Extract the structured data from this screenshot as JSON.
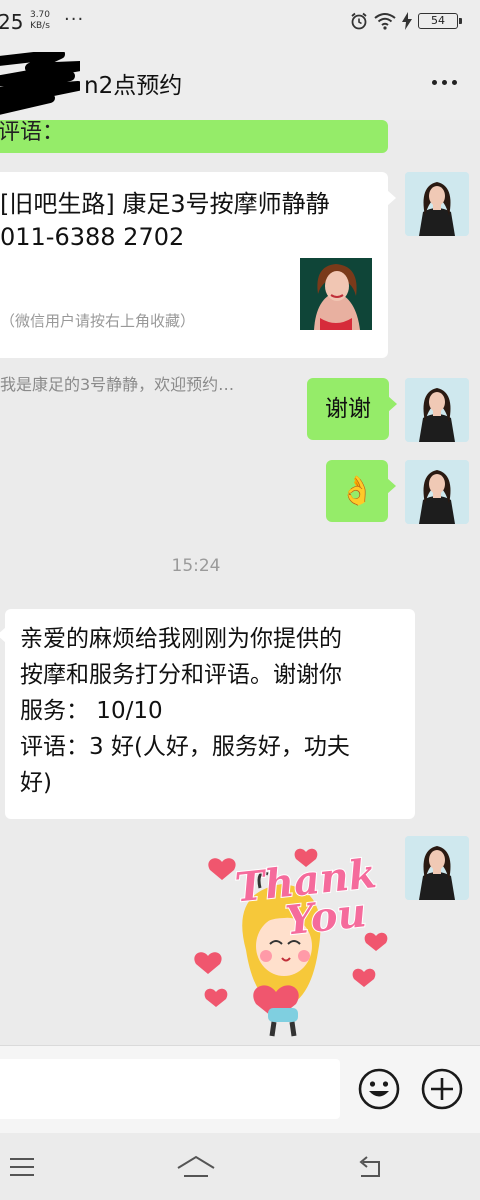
{
  "status_bar": {
    "time": "25",
    "speed_value": "3.70",
    "speed_unit": "KB/s",
    "dots": "···",
    "battery": "54"
  },
  "header": {
    "title": "n2点预约",
    "more_icon": "more-dots-icon"
  },
  "messages": {
    "partial_top": "评语：",
    "card": {
      "title": "[旧吧生路] 康足3号按摩师静静011-6388 2702",
      "note": "（微信用户请按右上角收藏）",
      "description": "我是康足的3号静静，欢迎预约…"
    },
    "thanks": "谢谢",
    "ok_emoji": "👌",
    "timestamp": "15:24",
    "long_lines": [
      "亲爱的麻烦给我刚刚为你提供的",
      "按摩和服务打分和评语。谢谢你",
      "服务： 10/10",
      "评语：3 好(人好，服务好，功夫",
      "好)"
    ],
    "sticker": {
      "line1": "Thank",
      "line2": "You"
    }
  },
  "input_bar": {
    "placeholder": "",
    "emoji_icon": "smiley-icon",
    "plus_icon": "plus-circle-icon"
  },
  "nav_bar": {
    "icons": [
      "menu-icon",
      "home-icon",
      "back-icon"
    ]
  },
  "colors": {
    "sent_bubble": "#95ec69",
    "received_bubble": "#ffffff",
    "chat_background": "#ebebeb"
  }
}
